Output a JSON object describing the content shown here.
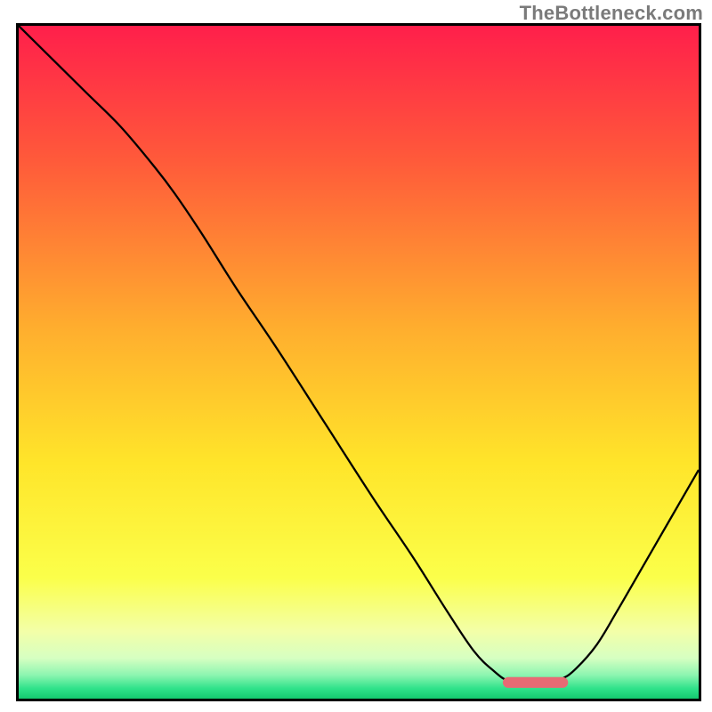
{
  "watermark": "TheBottleneck.com",
  "chart_data": {
    "type": "line",
    "title": "",
    "xlabel": "",
    "ylabel": "",
    "xlim": [
      0,
      100
    ],
    "ylim": [
      0,
      100
    ],
    "grid": false,
    "legend": false,
    "background_gradient": {
      "stops": [
        {
          "offset": 0.0,
          "color": "#ff1f4b"
        },
        {
          "offset": 0.2,
          "color": "#ff5a3a"
        },
        {
          "offset": 0.45,
          "color": "#ffae2e"
        },
        {
          "offset": 0.65,
          "color": "#ffe52a"
        },
        {
          "offset": 0.82,
          "color": "#fbff4a"
        },
        {
          "offset": 0.9,
          "color": "#f3ffa8"
        },
        {
          "offset": 0.94,
          "color": "#d6ffc2"
        },
        {
          "offset": 0.965,
          "color": "#8cf5b0"
        },
        {
          "offset": 0.985,
          "color": "#2fe28a"
        },
        {
          "offset": 1.0,
          "color": "#14c96f"
        }
      ]
    },
    "optimum_marker": {
      "x_start": 72,
      "x_end": 80,
      "y": 2.4,
      "color": "#e76b74",
      "thickness_pct": 1.6,
      "cap": "round"
    },
    "series": [
      {
        "name": "bottleneck-curve",
        "color": "#000000",
        "stroke_width_pct": 0.35,
        "x": [
          0,
          5,
          10,
          15,
          20,
          23,
          27,
          32,
          38,
          45,
          52,
          58,
          63,
          67,
          70,
          72,
          74,
          76,
          78,
          80,
          82,
          85,
          88,
          92,
          96,
          100
        ],
        "y": [
          100,
          95,
          90,
          85,
          79,
          75,
          69,
          61,
          52,
          41,
          30,
          21,
          13,
          7,
          4,
          2.6,
          2.2,
          2.2,
          2.4,
          3.0,
          4.5,
          8,
          13,
          20,
          27,
          34
        ]
      }
    ]
  }
}
